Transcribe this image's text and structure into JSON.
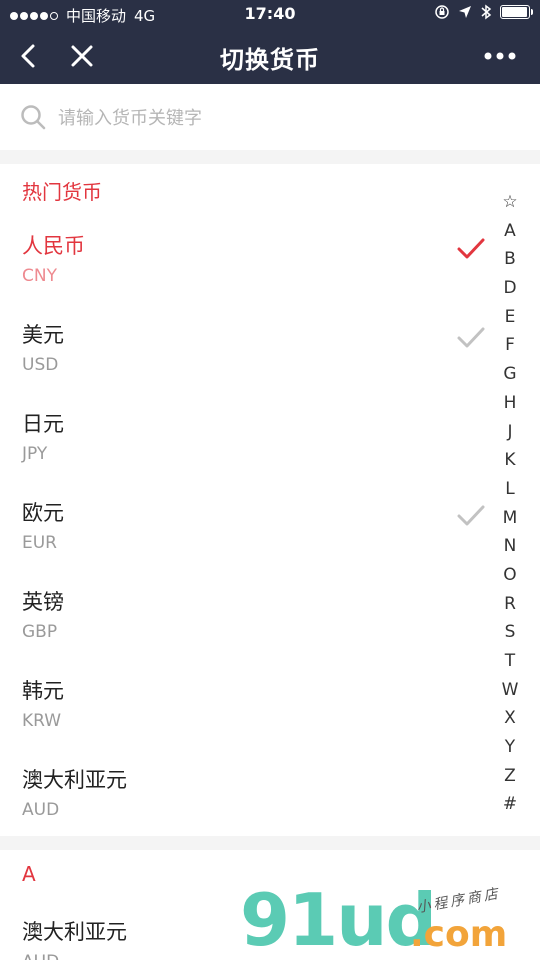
{
  "status_bar": {
    "carrier": "中国移动",
    "network": "4G",
    "time": "17:40",
    "battery_level": 0.95
  },
  "nav": {
    "title": "切换货币",
    "back_icon": "chevron-left-icon",
    "close_icon": "close-icon",
    "more_icon": "more-dots-icon"
  },
  "search": {
    "placeholder": "请输入货币关键字",
    "value": ""
  },
  "sections": {
    "hot_title": "热门货币",
    "a_title": "A"
  },
  "hot_currencies": [
    {
      "name": "人民币",
      "code": "CNY",
      "selected": true,
      "checked": true
    },
    {
      "name": "美元",
      "code": "USD",
      "selected": false,
      "checked": true
    },
    {
      "name": "日元",
      "code": "JPY",
      "selected": false,
      "checked": false
    },
    {
      "name": "欧元",
      "code": "EUR",
      "selected": false,
      "checked": true
    },
    {
      "name": "英镑",
      "code": "GBP",
      "selected": false,
      "checked": false
    },
    {
      "name": "韩元",
      "code": "KRW",
      "selected": false,
      "checked": false
    },
    {
      "name": "澳大利亚元",
      "code": "AUD",
      "selected": false,
      "checked": false
    }
  ],
  "a_currencies": [
    {
      "name": "澳大利亚元",
      "code": "AUD"
    }
  ],
  "index_letters": [
    "☆",
    "A",
    "B",
    "D",
    "E",
    "F",
    "G",
    "H",
    "J",
    "K",
    "L",
    "M",
    "N",
    "O",
    "R",
    "S",
    "T",
    "W",
    "X",
    "Y",
    "Z",
    "#"
  ],
  "watermark": {
    "brand": "91ud",
    "domain": ".com",
    "tagline": "小程序商店"
  },
  "colors": {
    "nav_bg": "#2a3045",
    "accent_red": "#e2363f",
    "check_gray": "#c2c2c2"
  }
}
